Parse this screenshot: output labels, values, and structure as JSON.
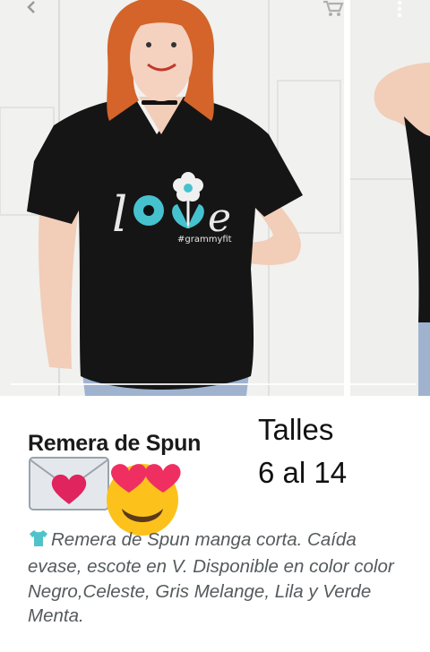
{
  "gallery": {
    "main_image_alt": "",
    "print_hashtag": "#grammyfit",
    "print_word": "love"
  },
  "toolbar": {
    "icons": [
      "back-icon",
      "cart-icon",
      "more-vert-icon"
    ]
  },
  "product": {
    "title": "Remera de Spun",
    "sizes_line1": "Talles",
    "sizes_line2": "6 al 14",
    "description": "Remera de Spun manga corta. Caída evase, escote en V. Disponible en color color Negro,Celeste, Gris Melange, Lila y Verde Menta."
  },
  "colors": {
    "shirt": "#111111",
    "print_accent": "#46c2cf",
    "hair": "#d4642a",
    "description_text": "#555a5d"
  }
}
